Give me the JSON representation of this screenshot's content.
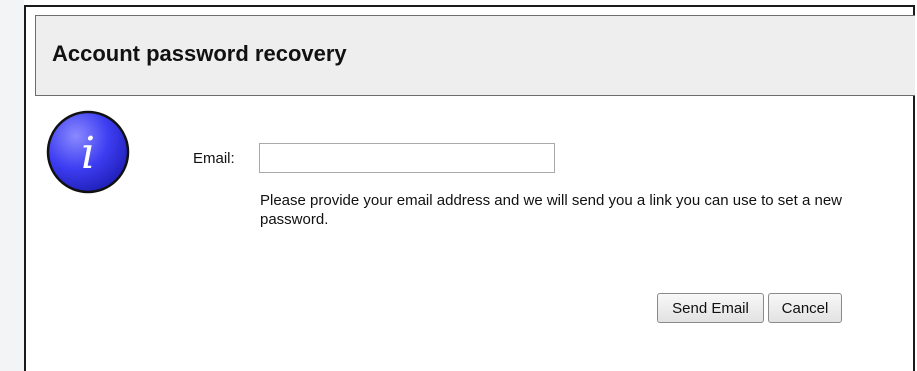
{
  "dialog": {
    "title": "Account password recovery",
    "info_icon_glyph": "i"
  },
  "form": {
    "email_label": "Email:",
    "email_value": "",
    "help_text": "Please provide your email address and we will send you a link you can use to set a new password."
  },
  "buttons": {
    "send_label": "Send Email",
    "cancel_label": "Cancel"
  },
  "icons": {
    "info": "info-icon"
  },
  "colors": {
    "info_icon_fill": "#3d3df2",
    "header_bg": "#eeeeee"
  }
}
